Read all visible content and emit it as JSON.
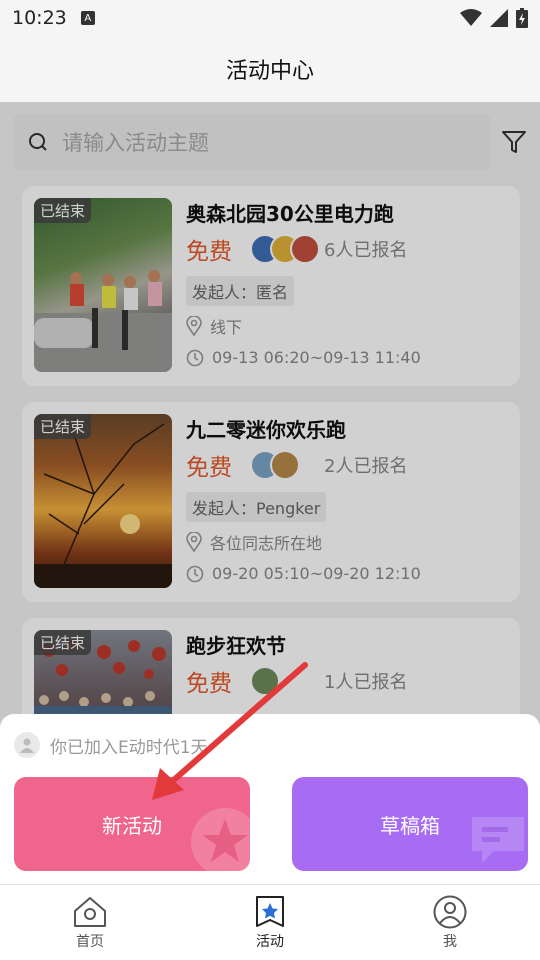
{
  "status": {
    "time": "10:23",
    "notif": "A"
  },
  "header": {
    "title": "活动中心"
  },
  "search": {
    "placeholder": "请输入活动主题"
  },
  "activities": [
    {
      "badge": "已结束",
      "title": "奥森北园30公里电力跑",
      "price": "免费",
      "signed": "6人已报名",
      "organizer": "发起人：匿名",
      "location": "线下",
      "time": "09-13 06:20~09-13 11:40"
    },
    {
      "badge": "已结束",
      "title": "九二零迷你欢乐跑",
      "price": "免费",
      "signed": "2人已报名",
      "organizer": "发起人：Pengker",
      "location": "各位同志所在地",
      "time": "09-20 05:10~09-20 12:10"
    },
    {
      "badge": "已结束",
      "title": "跑步狂欢节",
      "price": "免费",
      "signed": "1人已报名"
    }
  ],
  "sheet": {
    "joined_text": "你已加入E动时代1天",
    "new_button": "新活动",
    "draft_button": "草稿箱"
  },
  "tabs": [
    {
      "label": "首页",
      "icon": "home-icon"
    },
    {
      "label": "活动",
      "icon": "activity-star-icon"
    },
    {
      "label": "我",
      "icon": "profile-icon"
    }
  ],
  "colors": {
    "price": "#e55a2b",
    "new_button": "#f0658b",
    "draft_button": "#a76cf3",
    "arrow": "#e23a3a"
  }
}
